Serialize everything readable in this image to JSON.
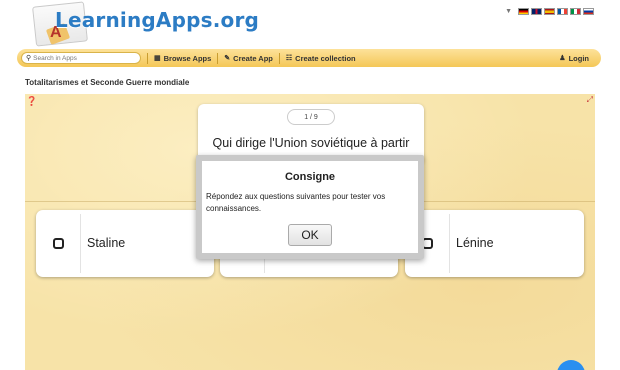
{
  "site": {
    "logo_text": "LearningApps.org"
  },
  "languages": [
    {
      "code": "de",
      "colors": [
        "#000000",
        "#dd0000",
        "#ffce00"
      ]
    },
    {
      "code": "gb",
      "colors": [
        "#012169",
        "#ffffff",
        "#c8102e"
      ]
    },
    {
      "code": "es",
      "colors": [
        "#aa151b",
        "#f1bf00",
        "#aa151b"
      ]
    },
    {
      "code": "fr",
      "colors": [
        "#0055a4",
        "#ffffff",
        "#ef4135"
      ]
    },
    {
      "code": "it",
      "colors": [
        "#009246",
        "#ffffff",
        "#ce2b37"
      ]
    },
    {
      "code": "ru",
      "colors": [
        "#ffffff",
        "#0039a6",
        "#d52b1e"
      ]
    }
  ],
  "nav": {
    "search_placeholder": "Search in Apps",
    "browse": "Browse Apps",
    "create": "Create App",
    "collection": "Create collection",
    "login": "Login"
  },
  "page": {
    "title": "Totalitarismes et Seconde Guerre mondiale"
  },
  "quiz": {
    "counter": "1 / 9",
    "question": "Qui dirige l'Union soviétique à partir",
    "answers": [
      "Staline",
      "",
      "Lénine"
    ]
  },
  "modal": {
    "title": "Consigne",
    "body": "Répondez aux questions suivantes pour tester vos connaissances.",
    "ok": "OK"
  },
  "colors": {
    "accent": "#2c7cc4",
    "navbar": "#f4c757",
    "app_bg": "#f7e3a8",
    "fab": "#2a8ff0"
  }
}
